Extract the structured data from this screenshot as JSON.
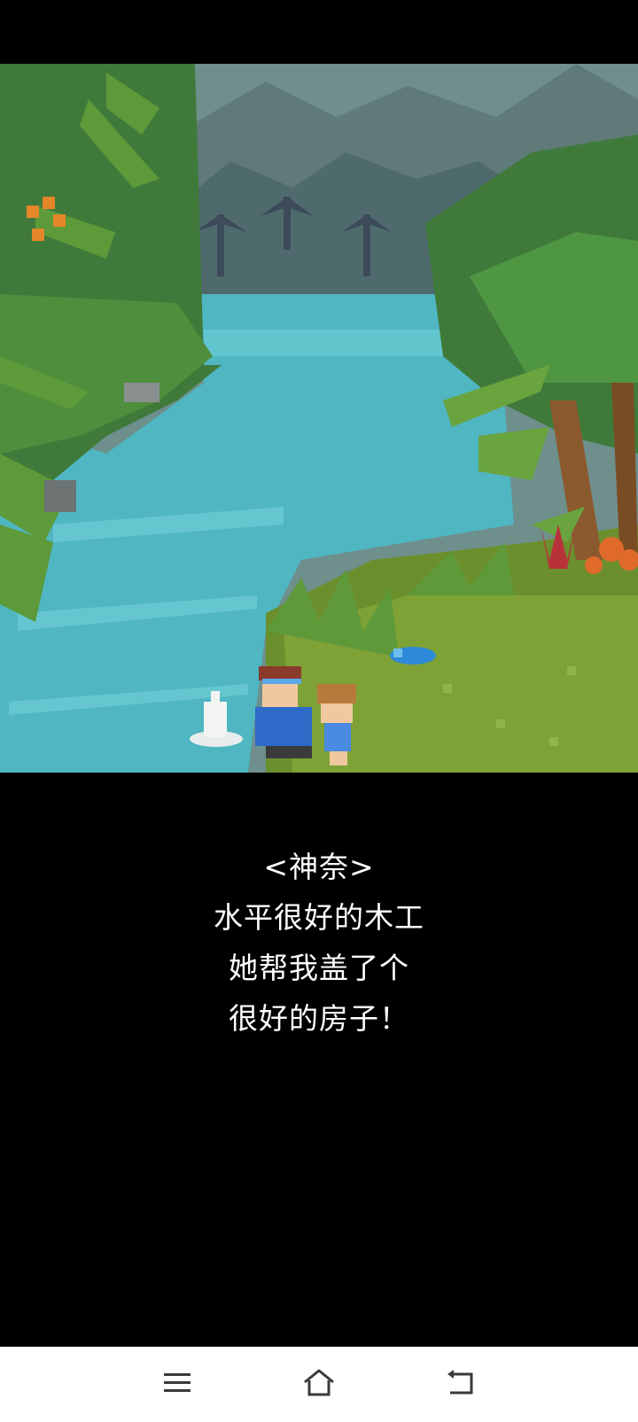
{
  "dialogue": {
    "speaker": "<神奈>",
    "lines": [
      "水平很好的木工",
      "她帮我盖了个",
      "很好的房子！"
    ]
  },
  "scene": {
    "description_icons": [
      "palm-tree-icon",
      "river",
      "character-boy",
      "character-girl",
      "blue-bird",
      "sake-bottle"
    ]
  },
  "colors": {
    "sky": "#6e8f8c",
    "mountain": "#5f7a78",
    "river": "#4fb6c2",
    "grass": "#6c8f2e",
    "foliage": "#3f7a3a",
    "background": "#000000",
    "text": "#ffffff",
    "navbar": "#ffffff",
    "nav_icon": "#3a3a3a"
  },
  "navbar": {
    "menu_icon": "menu-icon",
    "home_icon": "home-icon",
    "back_icon": "back-icon"
  }
}
